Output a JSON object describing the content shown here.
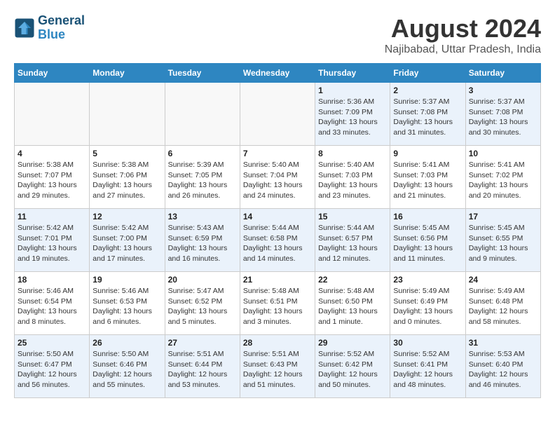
{
  "header": {
    "logo_line1": "General",
    "logo_line2": "Blue",
    "month_year": "August 2024",
    "location": "Najibabad, Uttar Pradesh, India"
  },
  "days_of_week": [
    "Sunday",
    "Monday",
    "Tuesday",
    "Wednesday",
    "Thursday",
    "Friday",
    "Saturday"
  ],
  "weeks": [
    [
      {
        "day": "",
        "info": ""
      },
      {
        "day": "",
        "info": ""
      },
      {
        "day": "",
        "info": ""
      },
      {
        "day": "",
        "info": ""
      },
      {
        "day": "1",
        "info": "Sunrise: 5:36 AM\nSunset: 7:09 PM\nDaylight: 13 hours and 33 minutes."
      },
      {
        "day": "2",
        "info": "Sunrise: 5:37 AM\nSunset: 7:08 PM\nDaylight: 13 hours and 31 minutes."
      },
      {
        "day": "3",
        "info": "Sunrise: 5:37 AM\nSunset: 7:08 PM\nDaylight: 13 hours and 30 minutes."
      }
    ],
    [
      {
        "day": "4",
        "info": "Sunrise: 5:38 AM\nSunset: 7:07 PM\nDaylight: 13 hours and 29 minutes."
      },
      {
        "day": "5",
        "info": "Sunrise: 5:38 AM\nSunset: 7:06 PM\nDaylight: 13 hours and 27 minutes."
      },
      {
        "day": "6",
        "info": "Sunrise: 5:39 AM\nSunset: 7:05 PM\nDaylight: 13 hours and 26 minutes."
      },
      {
        "day": "7",
        "info": "Sunrise: 5:40 AM\nSunset: 7:04 PM\nDaylight: 13 hours and 24 minutes."
      },
      {
        "day": "8",
        "info": "Sunrise: 5:40 AM\nSunset: 7:03 PM\nDaylight: 13 hours and 23 minutes."
      },
      {
        "day": "9",
        "info": "Sunrise: 5:41 AM\nSunset: 7:03 PM\nDaylight: 13 hours and 21 minutes."
      },
      {
        "day": "10",
        "info": "Sunrise: 5:41 AM\nSunset: 7:02 PM\nDaylight: 13 hours and 20 minutes."
      }
    ],
    [
      {
        "day": "11",
        "info": "Sunrise: 5:42 AM\nSunset: 7:01 PM\nDaylight: 13 hours and 19 minutes."
      },
      {
        "day": "12",
        "info": "Sunrise: 5:42 AM\nSunset: 7:00 PM\nDaylight: 13 hours and 17 minutes."
      },
      {
        "day": "13",
        "info": "Sunrise: 5:43 AM\nSunset: 6:59 PM\nDaylight: 13 hours and 16 minutes."
      },
      {
        "day": "14",
        "info": "Sunrise: 5:44 AM\nSunset: 6:58 PM\nDaylight: 13 hours and 14 minutes."
      },
      {
        "day": "15",
        "info": "Sunrise: 5:44 AM\nSunset: 6:57 PM\nDaylight: 13 hours and 12 minutes."
      },
      {
        "day": "16",
        "info": "Sunrise: 5:45 AM\nSunset: 6:56 PM\nDaylight: 13 hours and 11 minutes."
      },
      {
        "day": "17",
        "info": "Sunrise: 5:45 AM\nSunset: 6:55 PM\nDaylight: 13 hours and 9 minutes."
      }
    ],
    [
      {
        "day": "18",
        "info": "Sunrise: 5:46 AM\nSunset: 6:54 PM\nDaylight: 13 hours and 8 minutes."
      },
      {
        "day": "19",
        "info": "Sunrise: 5:46 AM\nSunset: 6:53 PM\nDaylight: 13 hours and 6 minutes."
      },
      {
        "day": "20",
        "info": "Sunrise: 5:47 AM\nSunset: 6:52 PM\nDaylight: 13 hours and 5 minutes."
      },
      {
        "day": "21",
        "info": "Sunrise: 5:48 AM\nSunset: 6:51 PM\nDaylight: 13 hours and 3 minutes."
      },
      {
        "day": "22",
        "info": "Sunrise: 5:48 AM\nSunset: 6:50 PM\nDaylight: 13 hours and 1 minute."
      },
      {
        "day": "23",
        "info": "Sunrise: 5:49 AM\nSunset: 6:49 PM\nDaylight: 13 hours and 0 minutes."
      },
      {
        "day": "24",
        "info": "Sunrise: 5:49 AM\nSunset: 6:48 PM\nDaylight: 12 hours and 58 minutes."
      }
    ],
    [
      {
        "day": "25",
        "info": "Sunrise: 5:50 AM\nSunset: 6:47 PM\nDaylight: 12 hours and 56 minutes."
      },
      {
        "day": "26",
        "info": "Sunrise: 5:50 AM\nSunset: 6:46 PM\nDaylight: 12 hours and 55 minutes."
      },
      {
        "day": "27",
        "info": "Sunrise: 5:51 AM\nSunset: 6:44 PM\nDaylight: 12 hours and 53 minutes."
      },
      {
        "day": "28",
        "info": "Sunrise: 5:51 AM\nSunset: 6:43 PM\nDaylight: 12 hours and 51 minutes."
      },
      {
        "day": "29",
        "info": "Sunrise: 5:52 AM\nSunset: 6:42 PM\nDaylight: 12 hours and 50 minutes."
      },
      {
        "day": "30",
        "info": "Sunrise: 5:52 AM\nSunset: 6:41 PM\nDaylight: 12 hours and 48 minutes."
      },
      {
        "day": "31",
        "info": "Sunrise: 5:53 AM\nSunset: 6:40 PM\nDaylight: 12 hours and 46 minutes."
      }
    ]
  ]
}
